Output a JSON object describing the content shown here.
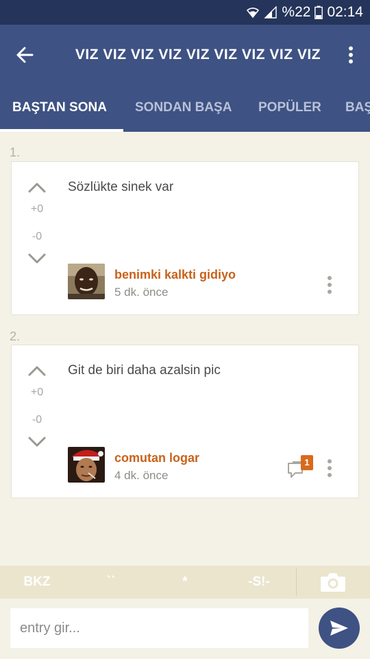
{
  "status_bar": {
    "battery_text": "%22",
    "time": "02:14"
  },
  "app_bar": {
    "title": "VIZ VIZ VIZ VIZ VIZ VIZ VIZ VIZ VIZ"
  },
  "tabs": [
    {
      "label": "BAŞTAN SONA",
      "active": true
    },
    {
      "label": "SONDAN BAŞA",
      "active": false
    },
    {
      "label": "POPÜLER",
      "active": false
    },
    {
      "label": "BAŞ",
      "active": false
    }
  ],
  "entries": [
    {
      "number": "1.",
      "text": "Sözlükte sinek var",
      "upvotes": "+0",
      "downvotes": "-0",
      "author": "benimki kalkti gidiyo",
      "time": "5 dk. önce",
      "comment_count": null
    },
    {
      "number": "2.",
      "text": "Git de biri daha azalsin pic",
      "upvotes": "+0",
      "downvotes": "-0",
      "author": "comutan logar",
      "time": "4 dk. önce",
      "comment_count": "1"
    }
  ],
  "format_bar": {
    "bkz": "BKZ",
    "backticks": "``",
    "star": "*",
    "spoiler": "-S!-"
  },
  "input": {
    "placeholder": "entry gir..."
  },
  "colors": {
    "app_bar": "#3e5283",
    "status_bar": "#25345a",
    "accent": "#c8621a",
    "background": "#f4f1e6"
  }
}
